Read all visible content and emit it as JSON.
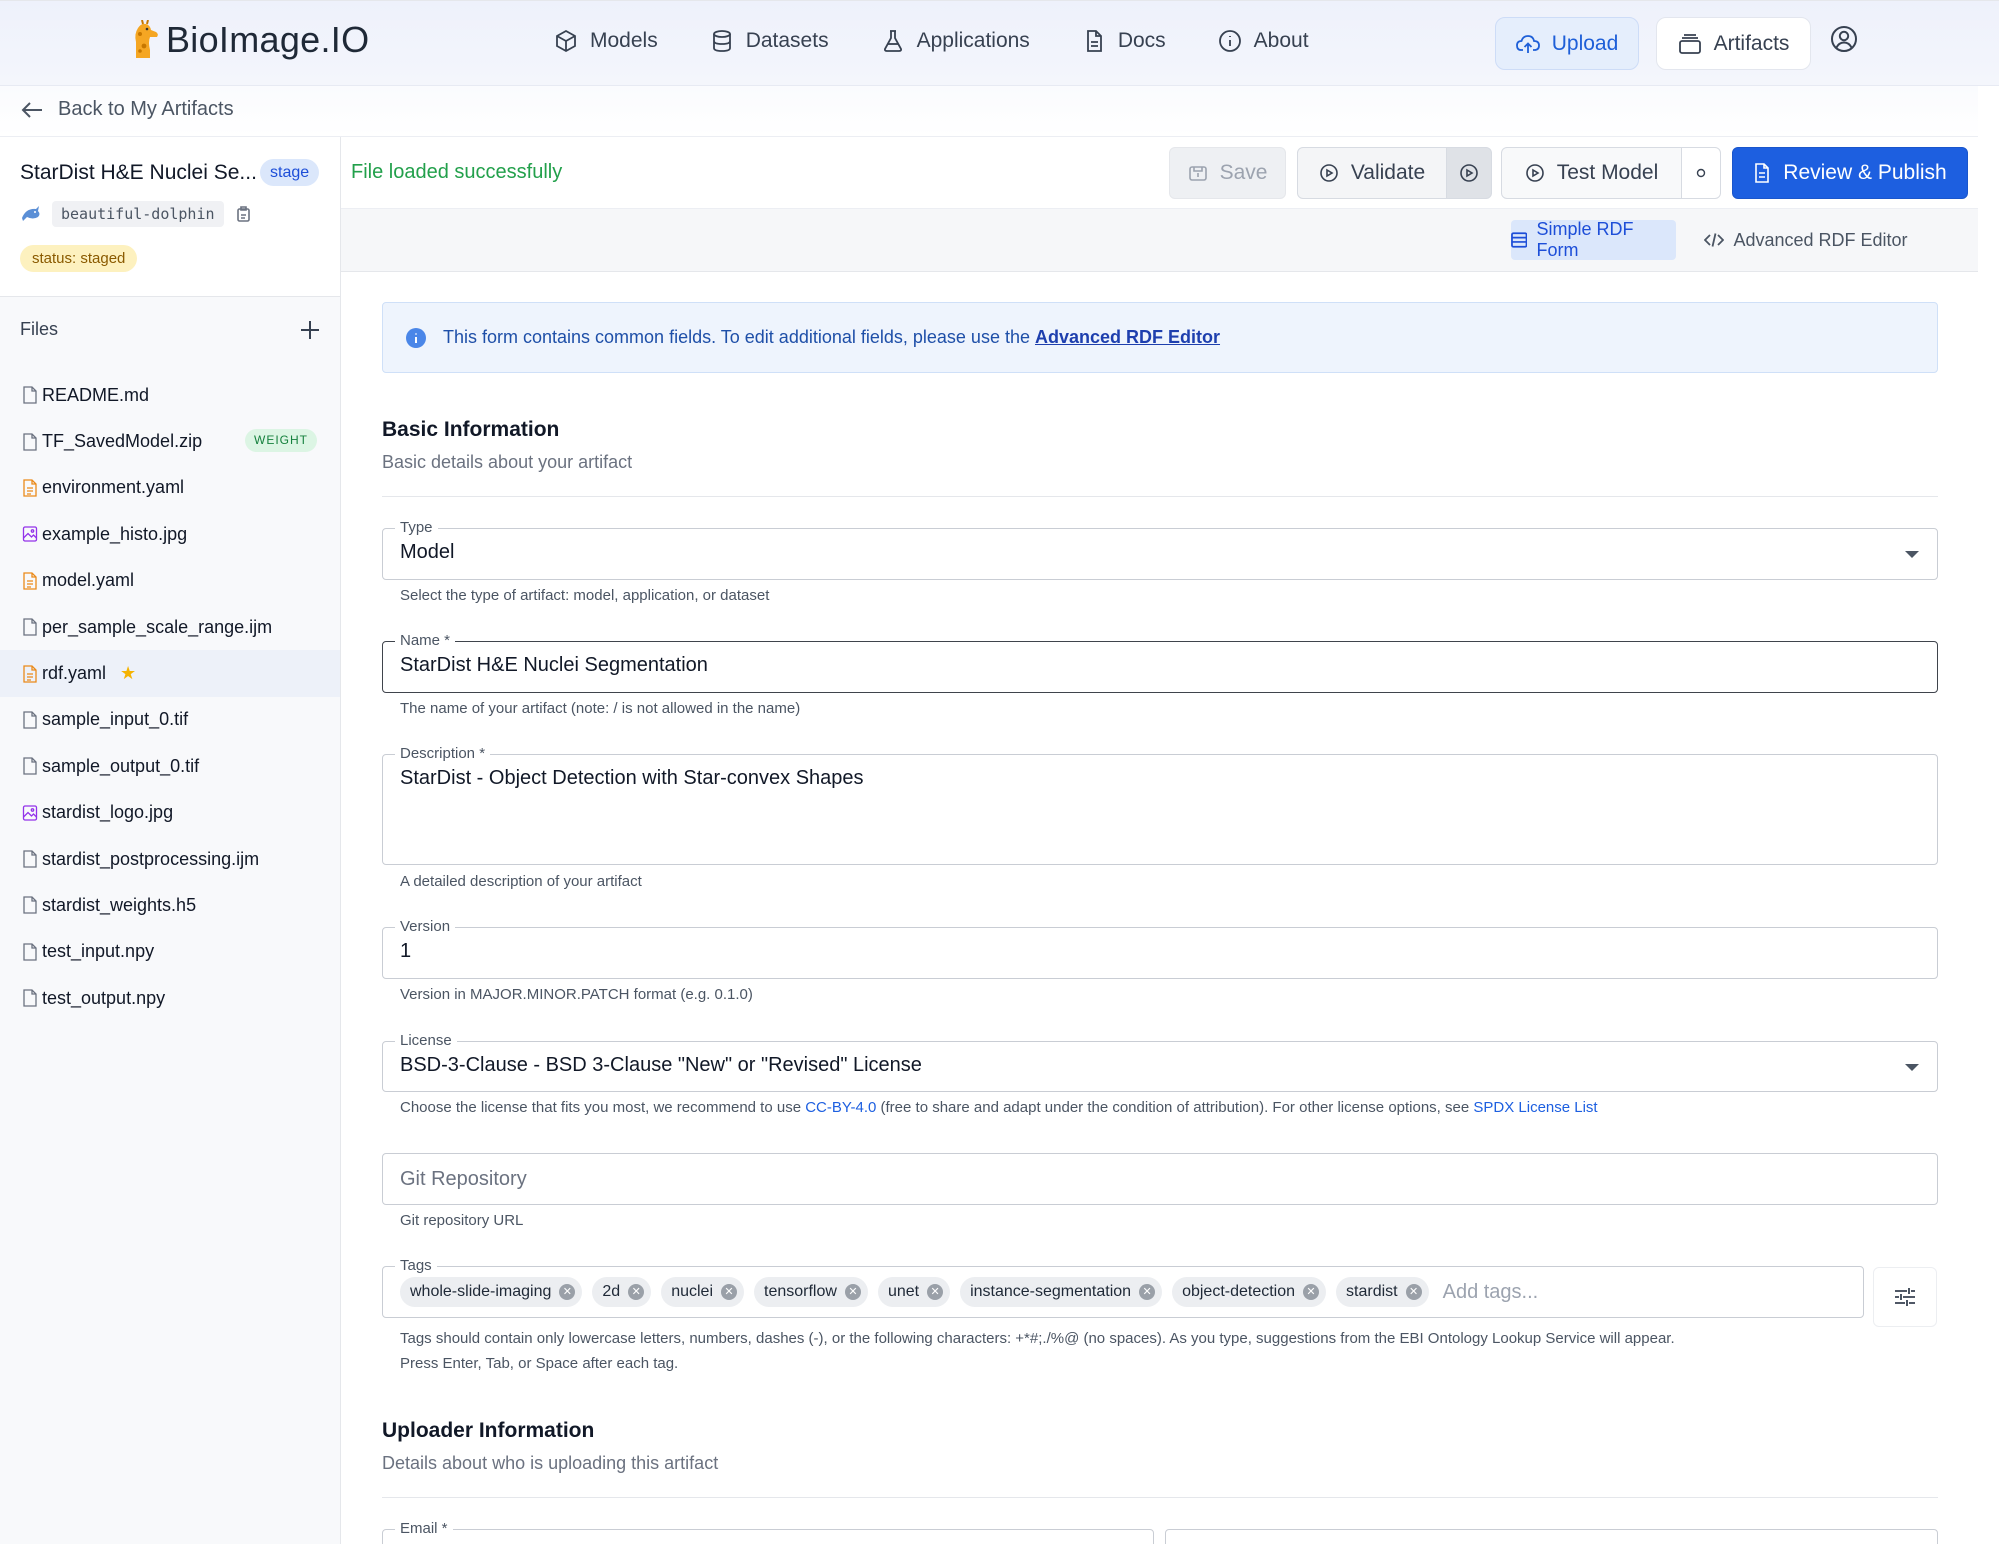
{
  "brand": {
    "name": "BioImage.IO"
  },
  "nav": {
    "items": [
      {
        "label": "Models",
        "icon": "cube-icon"
      },
      {
        "label": "Datasets",
        "icon": "database-icon"
      },
      {
        "label": "Applications",
        "icon": "flask-icon"
      },
      {
        "label": "Docs",
        "icon": "document-icon"
      },
      {
        "label": "About",
        "icon": "info-icon"
      }
    ],
    "upload_label": "Upload",
    "artifacts_label": "Artifacts"
  },
  "back": {
    "label": "Back to My Artifacts"
  },
  "artifact": {
    "title": "StarDist H&E Nuclei Se...",
    "stage_badge": "stage",
    "alias": "beautiful-dolphin",
    "status": "status: staged"
  },
  "files": {
    "title": "Files",
    "items": [
      {
        "name": "README.md",
        "type": "file"
      },
      {
        "name": "TF_SavedModel.zip",
        "type": "file",
        "badge": "WEIGHT"
      },
      {
        "name": "environment.yaml",
        "type": "yaml"
      },
      {
        "name": "example_histo.jpg",
        "type": "image"
      },
      {
        "name": "model.yaml",
        "type": "yaml"
      },
      {
        "name": "per_sample_scale_range.ijm",
        "type": "file"
      },
      {
        "name": "rdf.yaml",
        "type": "yaml",
        "active": true,
        "starred": true
      },
      {
        "name": "sample_input_0.tif",
        "type": "file"
      },
      {
        "name": "sample_output_0.tif",
        "type": "file"
      },
      {
        "name": "stardist_logo.jpg",
        "type": "image"
      },
      {
        "name": "stardist_postprocessing.ijm",
        "type": "file"
      },
      {
        "name": "stardist_weights.h5",
        "type": "file"
      },
      {
        "name": "test_input.npy",
        "type": "file"
      },
      {
        "name": "test_output.npy",
        "type": "file"
      }
    ]
  },
  "toolbar": {
    "status": "File loaded successfully",
    "save_label": "Save",
    "validate_label": "Validate",
    "test_label": "Test Model",
    "publish_label": "Review & Publish"
  },
  "mode": {
    "simple_label": "Simple RDF Form",
    "advanced_label": "Advanced RDF Editor"
  },
  "info": {
    "text": "This form contains common fields. To edit additional fields, please use the ",
    "link": "Advanced RDF Editor"
  },
  "basic": {
    "title": "Basic Information",
    "subtitle": "Basic details about your artifact",
    "type": {
      "label": "Type",
      "value": "Model",
      "help": "Select the type of artifact: model, application, or dataset"
    },
    "name": {
      "label": "Name *",
      "value": "StarDist H&E Nuclei Segmentation",
      "help": "The name of your artifact (note: / is not allowed in the name)"
    },
    "description": {
      "label": "Description *",
      "value": "StarDist - Object Detection with Star-convex Shapes",
      "help": "A detailed description of your artifact"
    },
    "version": {
      "label": "Version",
      "value": "1",
      "help": "Version in MAJOR.MINOR.PATCH format (e.g. 0.1.0)"
    },
    "license": {
      "label": "License",
      "value": "BSD-3-Clause - BSD 3-Clause \"New\" or \"Revised\" License",
      "help_pre": "Choose the license that fits you most, we recommend to use ",
      "help_link1": "CC-BY-4.0",
      "help_mid": " (free to share and adapt under the condition of attribution). For other license options, see ",
      "help_link2": "SPDX License List"
    },
    "git": {
      "placeholder": "Git Repository",
      "help": "Git repository URL"
    },
    "tags": {
      "label": "Tags",
      "items": [
        "whole-slide-imaging",
        "2d",
        "nuclei",
        "tensorflow",
        "unet",
        "instance-segmentation",
        "object-detection",
        "stardist"
      ],
      "placeholder": "Add tags...",
      "help_line1": "Tags should contain only lowercase letters, numbers, dashes (-), or the following characters: +*#;./%@ (no spaces). As you type, suggestions from the EBI Ontology Lookup Service will appear.",
      "help_line2": "Press Enter, Tab, or Space after each tag."
    }
  },
  "uploader": {
    "title": "Uploader Information",
    "subtitle": "Details about who is uploading this artifact",
    "email_label": "Email *"
  },
  "colors": {
    "primary": "#1d5fe0",
    "success": "#22a04b",
    "warning_bg": "#fdf1bf"
  }
}
